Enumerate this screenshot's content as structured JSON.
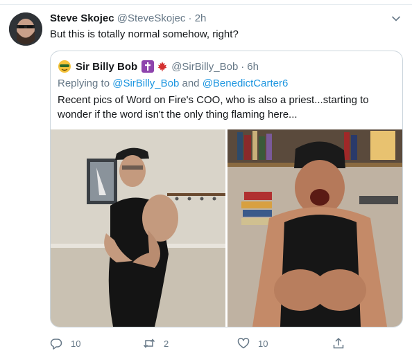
{
  "tweet": {
    "author_name": "Steve Skojec",
    "author_handle": "@SteveSkojec",
    "separator": "·",
    "time": "2h",
    "text": "But this is totally normal somehow, right?",
    "more_icon": "chevron-down-icon"
  },
  "quoted": {
    "author_name": "Sir Billy Bob",
    "author_handle": "@SirBilly_Bob",
    "separator": "·",
    "time": "6h",
    "reply_prefix": "Replying to",
    "reply_user_1": "@SirBilly_Bob",
    "reply_and": "and",
    "reply_user_2": "@BenedictCarter6",
    "text": "Recent pics of Word on Fire's COO, who is also a priest...starting to wonder if the word isn't the only thing flaming here..."
  },
  "actions": {
    "reply_count": "10",
    "retweet_count": "2",
    "like_count": "10"
  },
  "colors": {
    "link": "#1b95e0",
    "muted": "#657786",
    "border": "#ccd6dd"
  }
}
